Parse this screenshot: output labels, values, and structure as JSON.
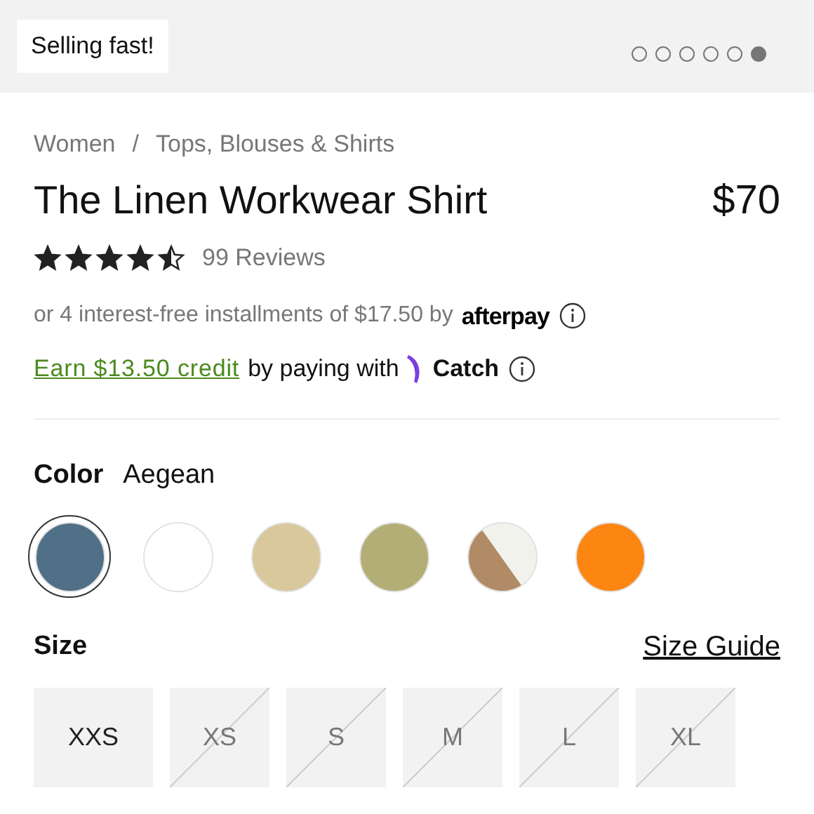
{
  "gallery": {
    "badge": "Selling fast!",
    "dots": [
      {
        "selected": false
      },
      {
        "selected": false
      },
      {
        "selected": false
      },
      {
        "selected": false
      },
      {
        "selected": false
      },
      {
        "selected": true
      }
    ]
  },
  "breadcrumb": [
    "Women",
    "/",
    "Tops, Blouses & Shirts"
  ],
  "product": {
    "title": "The Linen Workwear Shirt",
    "price": "$70",
    "stars": 4.5,
    "reviews": "99 Reviews"
  },
  "afterpay": {
    "text": "or 4 interest-free installments of $17.50 by",
    "brand": "afterpay"
  },
  "catch": {
    "link": "Earn $13.50 credit",
    "text": "by paying with",
    "brand": "Catch"
  },
  "color": {
    "label": "Color",
    "value": "Aegean",
    "swatches": [
      {
        "kind": "solid",
        "color": "#4f7086",
        "selected": true
      },
      {
        "kind": "solid",
        "color": "#ffffff",
        "selected": false
      },
      {
        "kind": "solid",
        "color": "#d9c89b",
        "selected": false
      },
      {
        "kind": "solid",
        "color": "#b2ae76",
        "selected": false
      },
      {
        "kind": "split",
        "color": "#b08b66",
        "selected": false
      },
      {
        "kind": "solid",
        "color": "#fd8612",
        "selected": false
      }
    ]
  },
  "size": {
    "label": "Size",
    "guide": "Size Guide",
    "options": [
      {
        "label": "XXS",
        "available": true
      },
      {
        "label": "XS",
        "available": false
      },
      {
        "label": "S",
        "available": false
      },
      {
        "label": "M",
        "available": false
      },
      {
        "label": "L",
        "available": false
      },
      {
        "label": "XL",
        "available": false
      }
    ]
  }
}
